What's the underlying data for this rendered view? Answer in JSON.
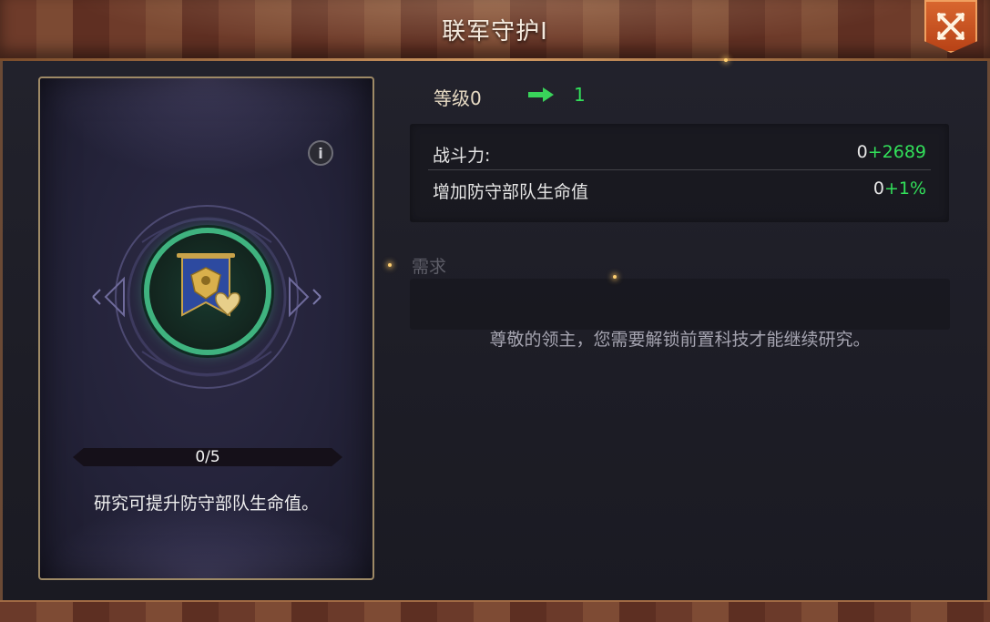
{
  "window": {
    "title": "联军守护I"
  },
  "card": {
    "progress_label": "0/5",
    "progress_value": 0,
    "progress_max": 5,
    "description": "研究可提升防守部队生命值。",
    "info_glyph": "i",
    "icon": "banner-heart-icon"
  },
  "level": {
    "current_label": "等级0",
    "next": "1"
  },
  "stats": [
    {
      "name": "战斗力:",
      "base": "0",
      "increase": "+2689"
    },
    {
      "name": "增加防守部队生命值",
      "base": "0",
      "increase": "+1%"
    }
  ],
  "requirements": {
    "title": "需求",
    "message": "尊敬的领主，您需要解锁前置科技才能继续研究。"
  },
  "colors": {
    "increase": "#32e05a",
    "close_button": "#d8662f",
    "medal_ring": "#3fb37f"
  }
}
